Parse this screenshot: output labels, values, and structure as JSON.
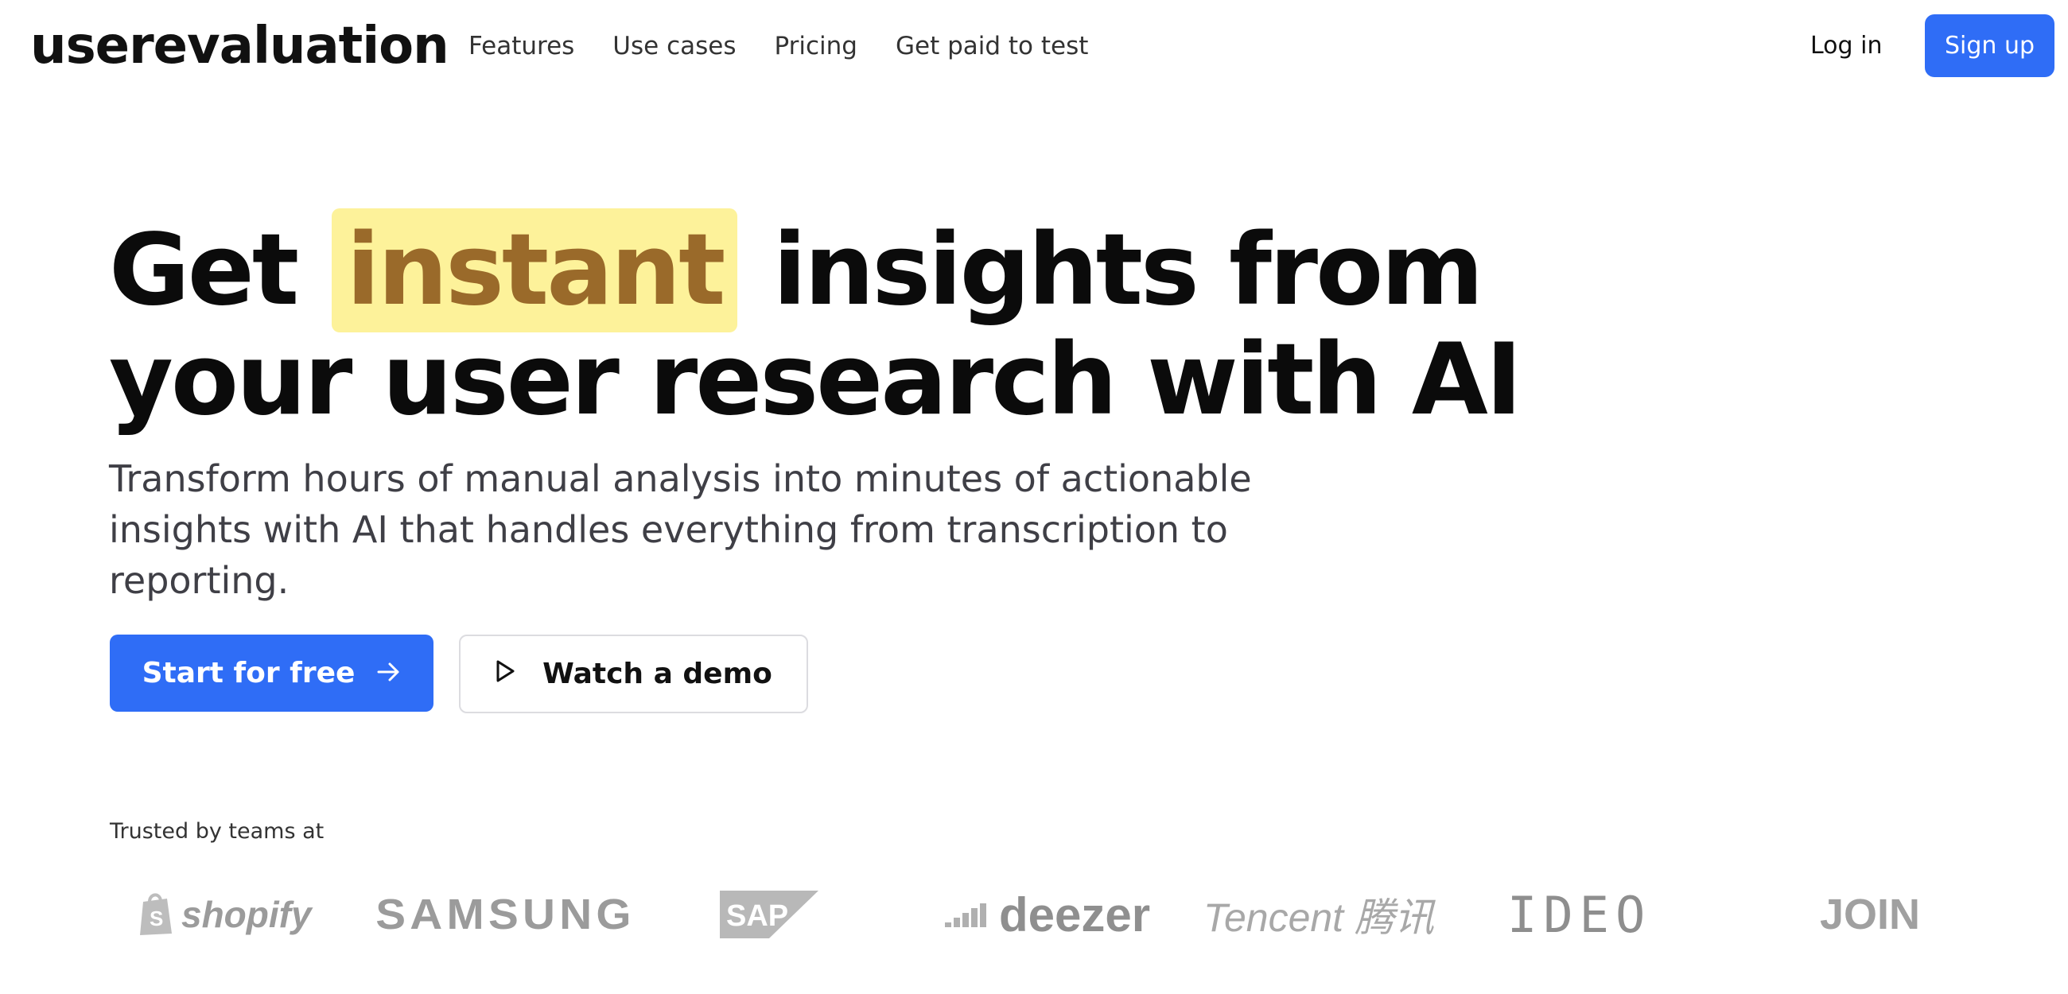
{
  "header": {
    "logo": "userevaluation",
    "nav": [
      "Features",
      "Use cases",
      "Pricing",
      "Get paid to test"
    ],
    "login": "Log in",
    "signup": "Sign up"
  },
  "hero": {
    "headline_before": "Get",
    "headline_highlight": "instant",
    "headline_after": "insights from your user research with AI",
    "subtext": "Transform hours of manual analysis into minutes of actionable insights with AI that handles everything from transcription to reporting.",
    "primary_cta": "Start for free",
    "secondary_cta": "Watch a demo"
  },
  "trusted": {
    "label": "Trusted by teams at",
    "logos": [
      "shopify",
      "SAMSUNG",
      "SAP",
      "deezer",
      "Tencent 腾讯",
      "IDEO",
      "JOIN"
    ]
  },
  "colors": {
    "accent": "#2f6df6",
    "highlight_bg": "#fdf29a",
    "highlight_text": "#9a6a2a",
    "logo_gray": "#9b9b9b"
  }
}
